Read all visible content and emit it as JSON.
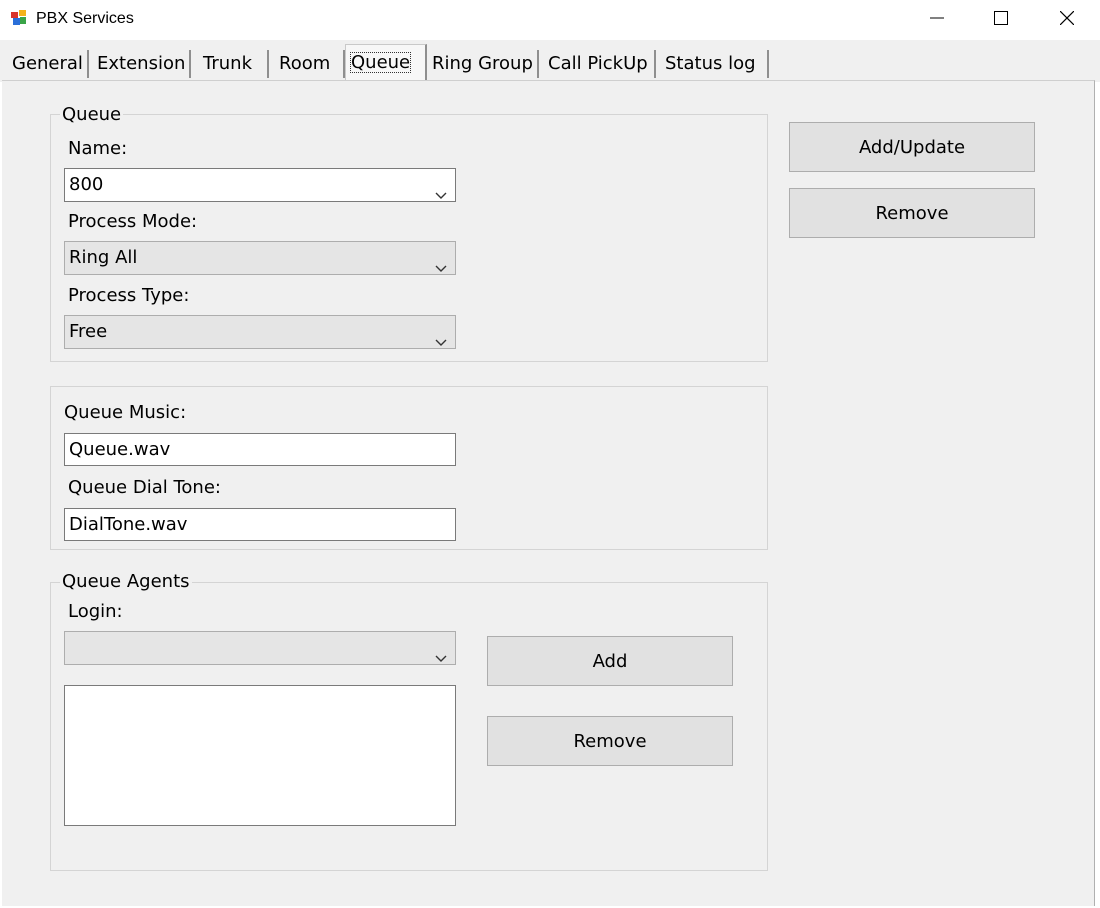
{
  "window": {
    "title": "PBX Services",
    "icons": {
      "app": "pbx-app-icon",
      "minimize": "minimize-icon",
      "maximize": "maximize-icon",
      "close": "close-icon"
    }
  },
  "tabs": [
    {
      "label": "General"
    },
    {
      "label": "Extension"
    },
    {
      "label": "Trunk"
    },
    {
      "label": "Room"
    },
    {
      "label": "Queue",
      "active": true
    },
    {
      "label": "Ring Group"
    },
    {
      "label": "Call PickUp"
    },
    {
      "label": "Status log"
    }
  ],
  "queue_group": {
    "legend": "Queue",
    "name_label": "Name:",
    "name_value": "800",
    "process_mode_label": "Process Mode:",
    "process_mode_value": "Ring All",
    "process_type_label": "Process Type:",
    "process_type_value": "Free"
  },
  "music_group": {
    "queue_music_label": "Queue Music:",
    "queue_music_value": "Queue.wav",
    "dial_tone_label": "Queue Dial Tone:",
    "dial_tone_value": "DialTone.wav"
  },
  "agents_group": {
    "legend": "Queue Agents",
    "login_label": "Login:",
    "login_value": "",
    "agents_list": [],
    "add_label": "Add",
    "remove_label": "Remove"
  },
  "actions": {
    "add_update_label": "Add/Update",
    "remove_label": "Remove"
  },
  "colors": {
    "window_bg": "#f0f0f0",
    "button_bg": "#e1e1e1",
    "field_border": "#7a7a7a"
  }
}
